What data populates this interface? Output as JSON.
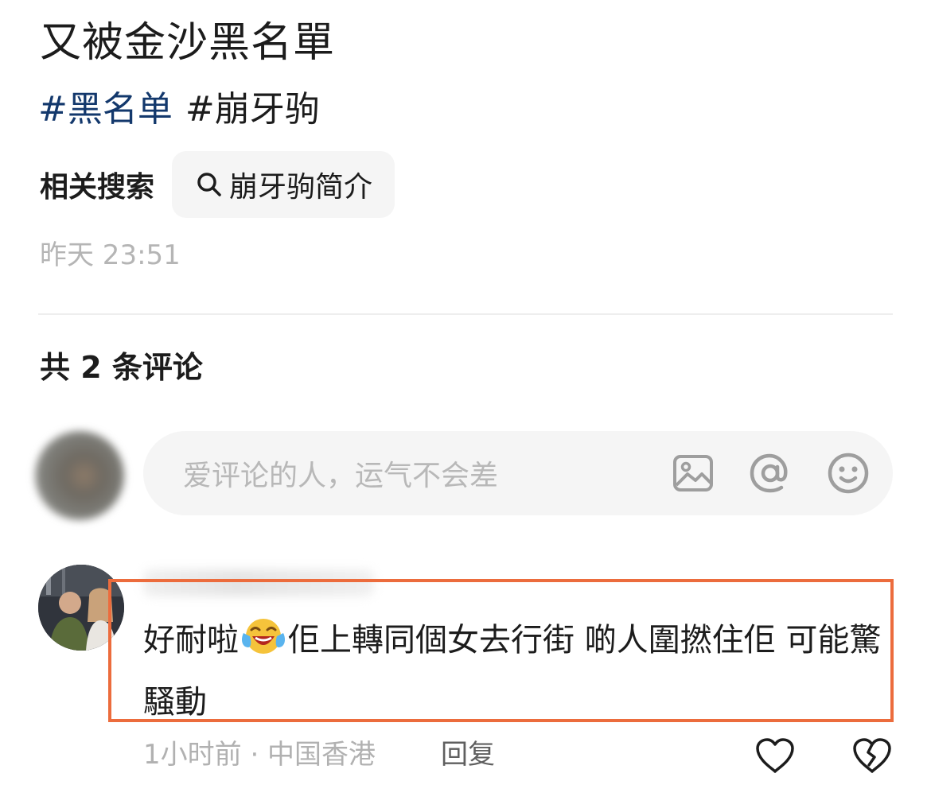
{
  "post": {
    "title": "又被金沙黑名單",
    "tags": [
      {
        "label": "#黑名单"
      },
      {
        "label": "#崩牙驹"
      }
    ]
  },
  "related_search": {
    "label": "相关搜索",
    "chip": "崩牙驹简介"
  },
  "timestamp": "昨天 23:51",
  "comments_section": {
    "count_text": "共 2 条评论",
    "input_placeholder": "爱评论的人，运气不会差",
    "input_icons": [
      "image-icon",
      "at-icon",
      "emoji-icon"
    ]
  },
  "comment": {
    "text_before_emoji": "好耐啦",
    "emoji_name": "laughing-crying-emoji",
    "text_after_emoji": "佢上轉同個女去行街 啲人圍撚住佢 可能驚騷動",
    "meta": "1小时前 · 中国香港",
    "reply_label": "回复",
    "actions": [
      "heart-icon",
      "broken-heart-icon"
    ]
  },
  "colors": {
    "tag_link": "#13386c",
    "highlight_border": "#ec6c3d",
    "muted_text": "#b5b5b5"
  }
}
